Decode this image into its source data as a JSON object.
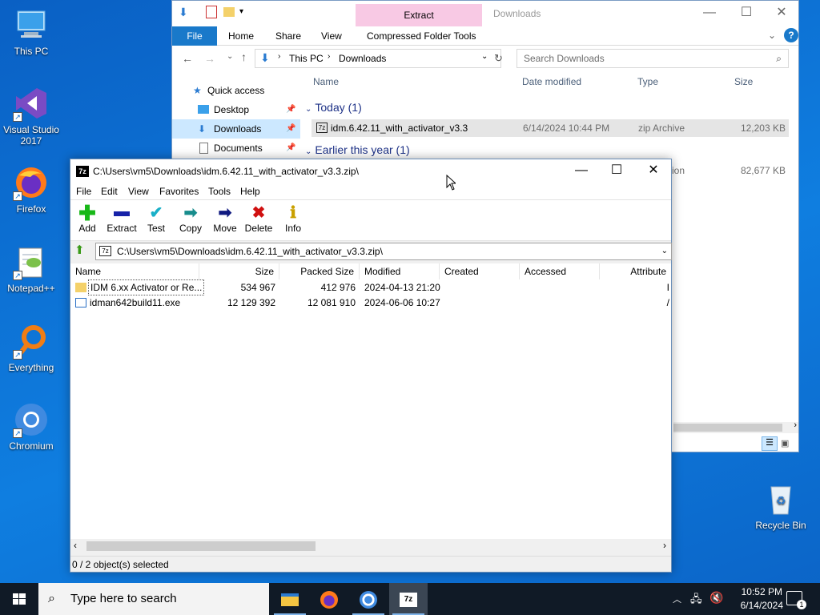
{
  "desktop": {
    "icons": [
      {
        "label": "This PC"
      },
      {
        "label": "Visual Studio 2017"
      },
      {
        "label": "Firefox"
      },
      {
        "label": "Notepad++"
      },
      {
        "label": "Everything"
      },
      {
        "label": "Chromium"
      }
    ],
    "recycle_bin": "Recycle Bin"
  },
  "explorer": {
    "title": "Downloads",
    "contextual_tab": "Extract",
    "tabs": [
      "File",
      "Home",
      "Share",
      "View",
      "Compressed Folder Tools"
    ],
    "breadcrumb": [
      "This PC",
      "Downloads"
    ],
    "search_placeholder": "Search Downloads",
    "nav": [
      {
        "label": "Quick access"
      },
      {
        "label": "Desktop"
      },
      {
        "label": "Downloads"
      },
      {
        "label": "Documents"
      }
    ],
    "columns": [
      "Name",
      "Date modified",
      "Type",
      "Size"
    ],
    "groups": [
      {
        "label": "Today (1)"
      },
      {
        "label": "Earlier this year (1)"
      }
    ],
    "files": [
      {
        "name": "idm.6.42.11_with_activator_v3.3",
        "date": "6/14/2024 10:44 PM",
        "type": "zip Archive",
        "size": "12,203 KB"
      },
      {
        "name": "",
        "date": "",
        "type": "ion",
        "size": "82,677 KB"
      }
    ]
  },
  "sevenzip": {
    "title": "C:\\Users\\vm5\\Downloads\\idm.6.42.11_with_activator_v3.3.zip\\",
    "menu": [
      "File",
      "Edit",
      "View",
      "Favorites",
      "Tools",
      "Help"
    ],
    "toolbar": [
      "Add",
      "Extract",
      "Test",
      "Copy",
      "Move",
      "Delete",
      "Info"
    ],
    "path": "C:\\Users\\vm5\\Downloads\\idm.6.42.11_with_activator_v3.3.zip\\",
    "columns": [
      "Name",
      "Size",
      "Packed Size",
      "Modified",
      "Created",
      "Accessed",
      "Attribute"
    ],
    "rows": [
      {
        "name": "IDM 6.xx Activator or Re...",
        "size": "534 967",
        "packed": "412 976",
        "modified": "2024-04-13 21:20",
        "attr": "I"
      },
      {
        "name": "idman642build11.exe",
        "size": "12 129 392",
        "packed": "12 081 910",
        "modified": "2024-06-06 10:27",
        "attr": "/"
      }
    ],
    "status": "0 / 2 object(s) selected"
  },
  "taskbar": {
    "search_placeholder": "Type here to search",
    "time": "10:52 PM",
    "date": "6/14/2024",
    "notification_count": "1"
  },
  "colors": {
    "accent": "#0063b1",
    "contextual": "#f8c9e4",
    "taskbar": "#101a26"
  }
}
